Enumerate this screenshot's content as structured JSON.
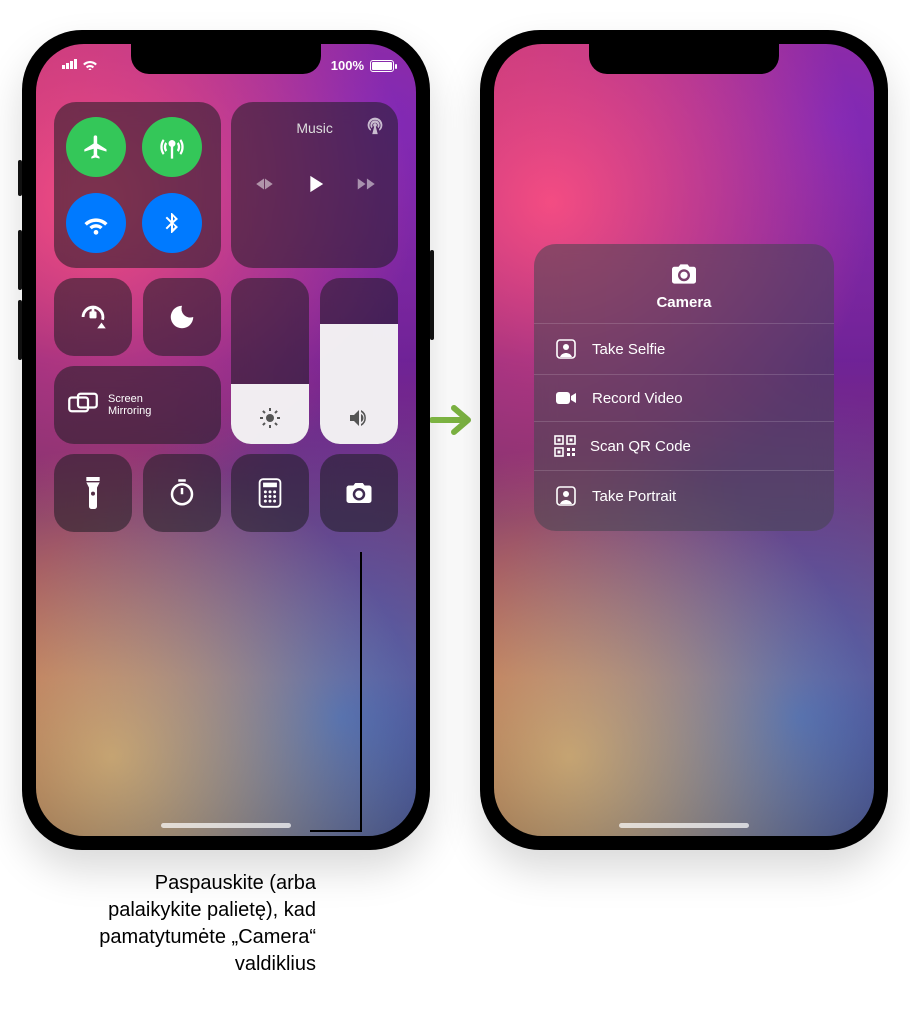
{
  "status": {
    "battery_label": "100%"
  },
  "control_center": {
    "music_label": "Music",
    "screen_mirroring_label": "Screen\nMirroring"
  },
  "camera_panel": {
    "title": "Camera",
    "items": [
      {
        "label": "Take Selfie"
      },
      {
        "label": "Record Video"
      },
      {
        "label": "Scan QR Code"
      },
      {
        "label": "Take Portrait"
      }
    ]
  },
  "callout": "Paspauskite (arba palaikykite palietę), kad pamatytumėte „Camera“ valdiklius"
}
